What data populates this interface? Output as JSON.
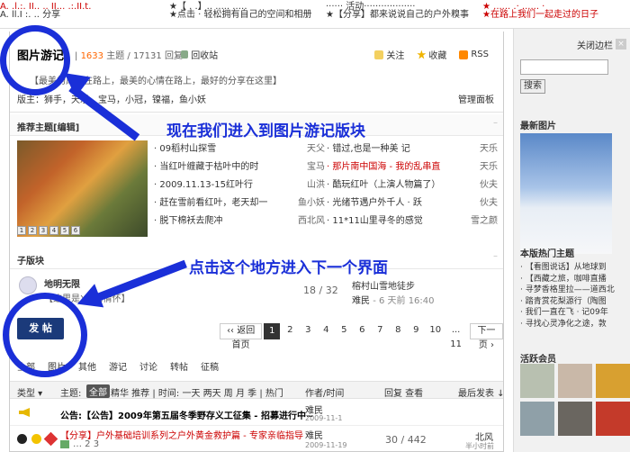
{
  "top_news": [
    {
      "text": "A. .l.:. II.. .. II... .:.II.t.",
      "color": "red"
    },
    {
      "text": "A. ll.I :. .. 分享",
      "color": "dark"
    },
    {
      "text": "★【 . .】.. ..... ..…",
      "color": "dark"
    },
    {
      "text": "★点击 · 轻松拥有自己的空间和相册",
      "color": "dark"
    },
    {
      "text": "······ 活动··················",
      "color": "dark"
    },
    {
      "text": "★【分享】都来说说自己的户外糗事",
      "color": "dark"
    },
    {
      "text": "★ ...... .· ...... ·",
      "color": "red"
    },
    {
      "text": "★在路上我们一起走过的日子",
      "color": "red"
    }
  ],
  "forum": {
    "title": "图片游记",
    "topics_prefix": "|",
    "topics": "1633",
    "topics_label": "主题",
    "posts": "17131",
    "posts_label": "回复",
    "recycle": "回收站",
    "actions": [
      "关注",
      "收藏",
      "RSS"
    ],
    "description": "【最美的风景在路上，最美的心情在路上，最好的分享在这里】",
    "moderators": "版主：狮手，天乐，宝马，小冠，镍福，鱼小妖",
    "mod_panel": "管理面板"
  },
  "recommended": {
    "header": "推荐主题[编辑]",
    "pager": [
      "1",
      "2",
      "3",
      "4",
      "5",
      "6"
    ],
    "left": [
      {
        "title": "· 09稻村山探雪",
        "author": "天父"
      },
      {
        "title": "· 当红叶缠藏于枯叶中的时",
        "author": "宝马"
      },
      {
        "title": "· 2009.11.13-15红叶行",
        "author": "山洪"
      },
      {
        "title": "· 赶在雪前看红叶，老天却一",
        "author": "鱼小妖"
      },
      {
        "title": "· 脱下棉袄去爬冲",
        "author": "西北风"
      }
    ],
    "right": [
      {
        "title": "· 错过,也是一种美 记",
        "author": "天乐"
      },
      {
        "title": "· 那片南中国海 - 我的乱串直",
        "author": "天乐"
      },
      {
        "title": "· 酷玩红叶（上演人物篇了）",
        "author": "伙夫"
      },
      {
        "title": "· 光绪节遇户外千人 · 跃",
        "author": "伙夫"
      },
      {
        "title": "· 11*11山里寻冬的感觉",
        "author": "雪之颜"
      }
    ]
  },
  "subforum": {
    "header": "子版块",
    "name": "地明无限",
    "desc": "【这里是XM的情怀】",
    "count": "18 / 32",
    "last_title": "榕村山雪地徒步",
    "last_author": "难民",
    "last_time": "- 6 天前 16:40"
  },
  "post_button": "发 帖",
  "pager": {
    "back": "‹‹ 返回首页",
    "pages": [
      "1",
      "2",
      "3",
      "4",
      "5",
      "6",
      "7",
      "8",
      "9",
      "10"
    ],
    "ellipsis": "... 11",
    "next": "下一页 ›"
  },
  "filter_tabs": [
    "全部",
    "图片",
    "其他",
    "游记",
    "讨论",
    "转帖",
    "征稿"
  ],
  "thread_header": {
    "type": "类型",
    "theme": "主题:",
    "all": "全部",
    "filters": "精华 推荐 | 时间: 一天 两天 周 月 季 | 热门",
    "author": "作者/时间",
    "replies": "回复 查看",
    "last": "最后发表 ↓"
  },
  "threads": [
    {
      "title": "公告:【公告】2009年第五届冬季野存义工征集 - 招募进行中~",
      "author": "难民",
      "time": "2009-11-1"
    },
    {
      "title": "【分享】户外基础培训系列之户外黄金救护篇 - 专家亲临指导",
      "pages": "… 2 3",
      "author": "难民",
      "time": "2009-11-19",
      "counts": "30 / 442",
      "last_author": "北风",
      "last_time": "半小时前"
    }
  ],
  "annotations": {
    "first": "现在我们进入到图片游记版块",
    "second": "点击这个地方进入下一个界面"
  },
  "sidebar": {
    "close": "关闭边栏",
    "search_placeholder": "",
    "search_btn": "搜索",
    "latest_images": "最新图片",
    "hot_topics_title": "本版热门主题",
    "hot_topics": [
      "· 【看图说话】从地球到",
      "· 【西藏之旅，咖啡直播",
      "· 寻梦香格里拉——道西北",
      "· 踏青赏花梨源行（陶图",
      "· 我们一直在飞 · 记09年",
      "· 寻找心灵净化之途，敦"
    ],
    "active_members": "活跃会员"
  },
  "colors": {
    "annotation_blue": "#1a2fd8",
    "post_button": "#1b3a7a",
    "count_orange": "#f60",
    "link_red": "#c00"
  }
}
